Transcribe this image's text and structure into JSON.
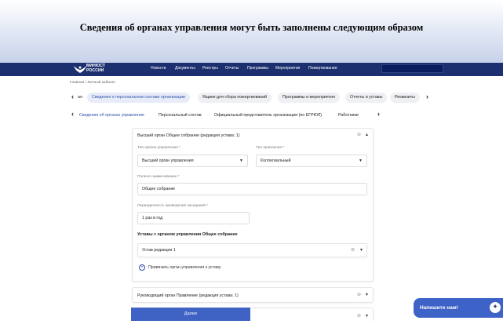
{
  "slide": {
    "title": "Сведения об органах управления могут быть заполнены следующим образом"
  },
  "header": {
    "logo_line1": "МИНЮСТ",
    "logo_line2": "РОССИИ",
    "nav": [
      "Новости",
      "Документы",
      "Реестры",
      "Отчеты",
      "Программы",
      "Мероприятия",
      "Пожертвования"
    ]
  },
  "breadcrumb": "Главная / Личный кабинет",
  "main_tabs": {
    "first": "ая",
    "items": [
      "Сведения о персональном составе организации",
      "Ящики для сбора пожертвований",
      "Программы и мероприятия",
      "Отчеты и уставы",
      "Реквизиты"
    ],
    "active_index": 0
  },
  "sub_tabs": {
    "items": [
      "Сведения об органах управления",
      "Персональный состав",
      "Официальный представитель организации (по ЕГРЮЛ)",
      "Работники"
    ],
    "active_index": 0
  },
  "card1": {
    "title": "Высший орган Общее собрание (редакция устава: 1)",
    "type_label": "Тип органа управления *",
    "type_value": "Высший орган управления",
    "kind_label": "Тип правления *",
    "kind_value": "Коллегиальный",
    "name_label": "Полное наименование *",
    "name_value": "Общее собрание",
    "period_label": "Периодичность проведения заседаний *",
    "period_value": "1 раз в год",
    "charters_label": "Уставы с органом управления Общее собрание",
    "charter_value": "Устав редакции 1",
    "bind_link": "Привязать орган управления к уставу"
  },
  "card2": {
    "title": "Руководящий орган Правление (редакция устава: 1)"
  },
  "card3": {
    "title": ""
  },
  "next_button": "Далее",
  "chat": {
    "label": "Напишите нам!"
  }
}
